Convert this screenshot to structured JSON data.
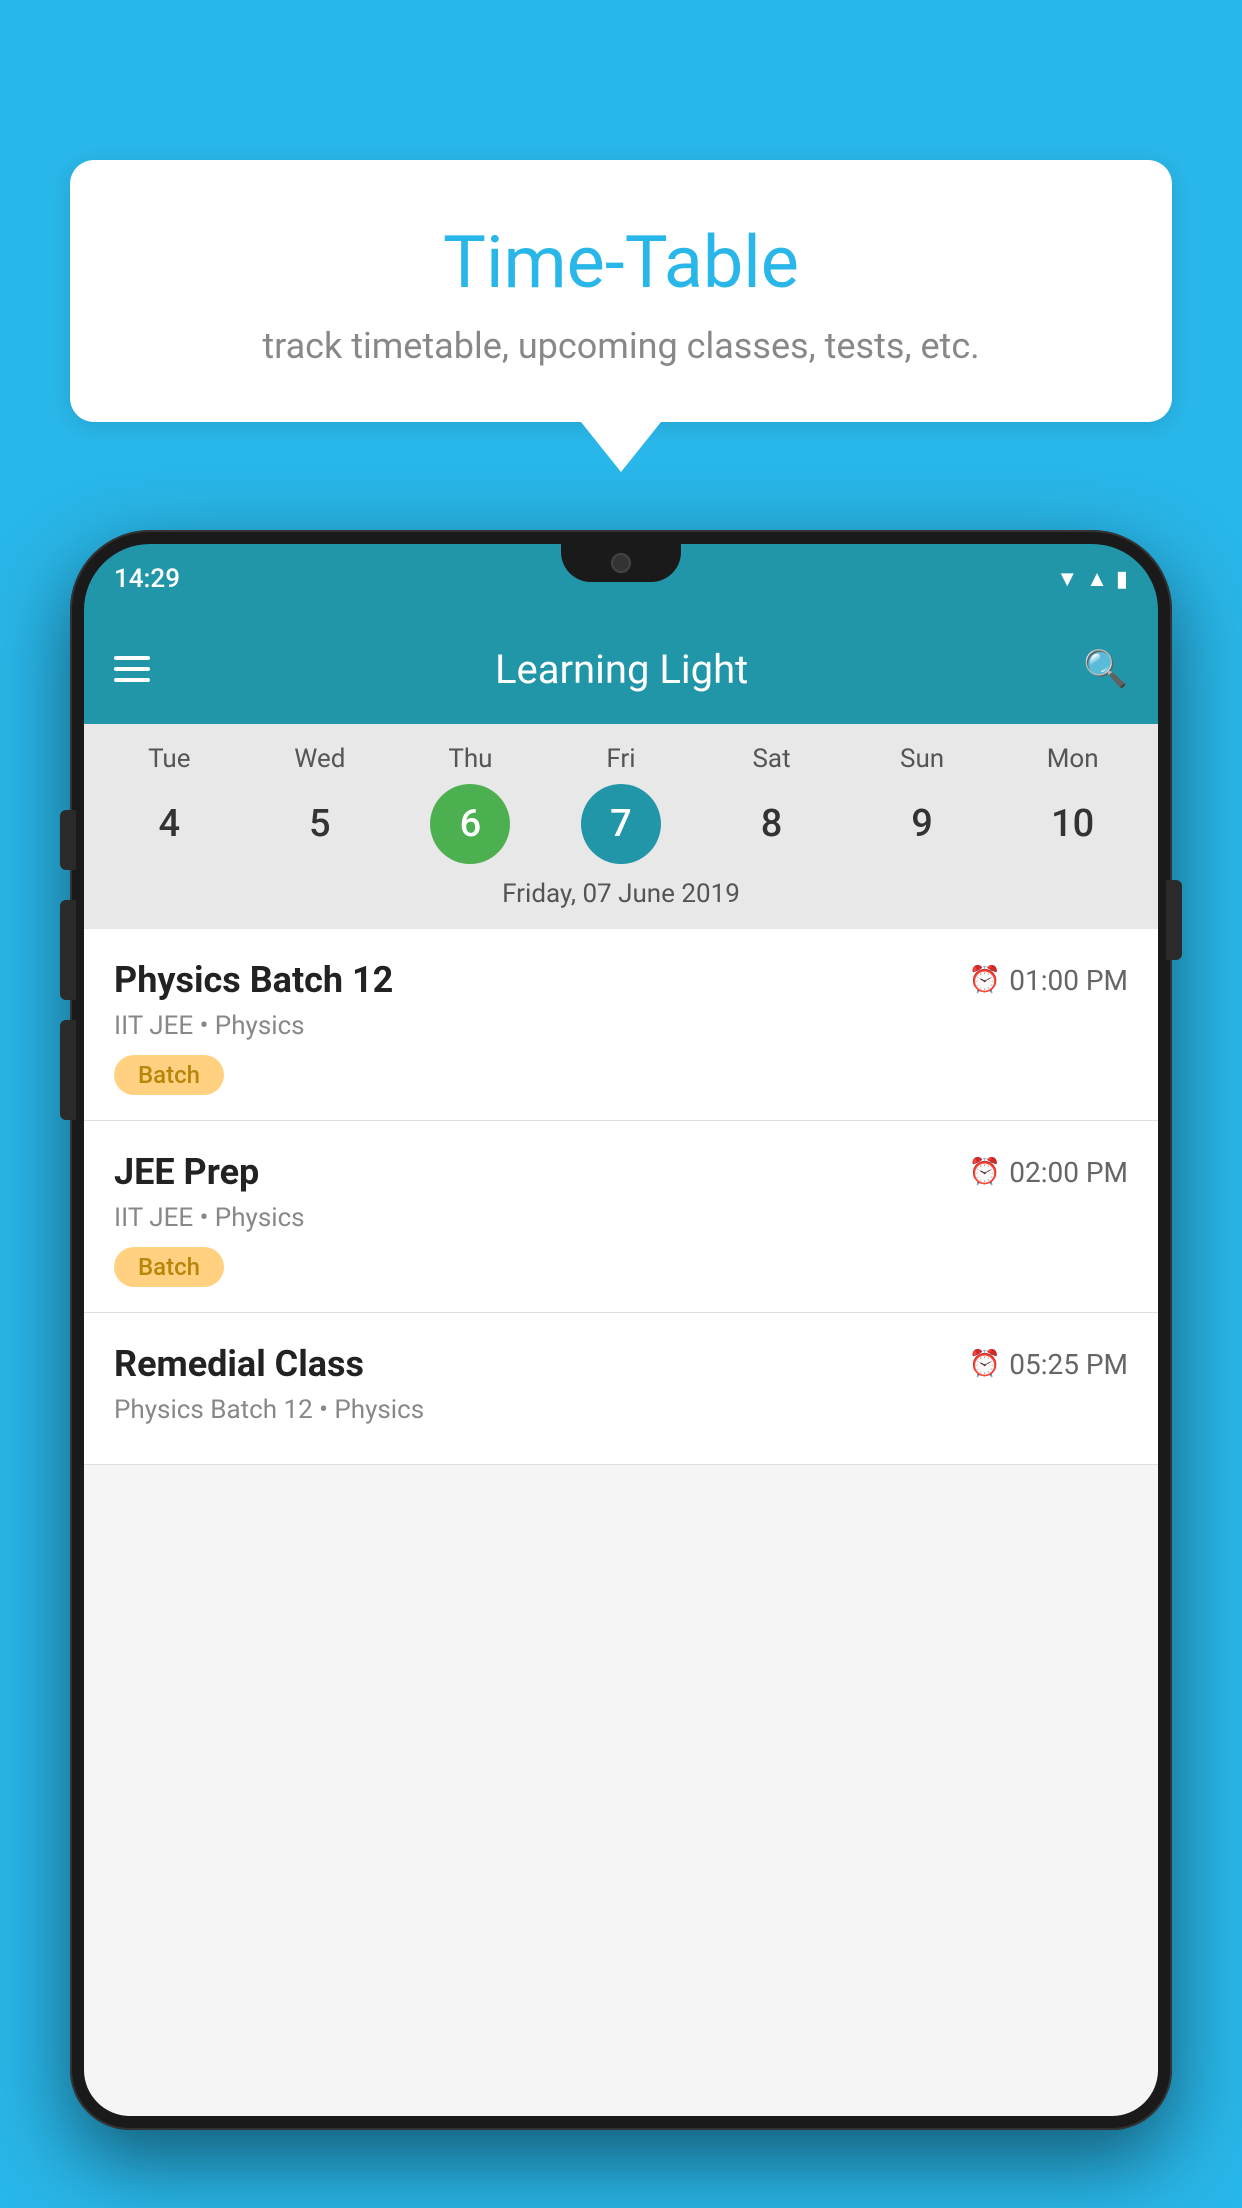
{
  "background_color": "#29b6e8",
  "speech_bubble": {
    "title": "Time-Table",
    "subtitle": "track timetable, upcoming classes, tests, etc."
  },
  "phone": {
    "status_bar": {
      "time": "14:29"
    },
    "app_bar": {
      "title": "Learning Light"
    },
    "calendar": {
      "days": [
        {
          "label": "Tue",
          "number": "4"
        },
        {
          "label": "Wed",
          "number": "5"
        },
        {
          "label": "Thu",
          "number": "6",
          "state": "today"
        },
        {
          "label": "Fri",
          "number": "7",
          "state": "selected"
        },
        {
          "label": "Sat",
          "number": "8"
        },
        {
          "label": "Sun",
          "number": "9"
        },
        {
          "label": "Mon",
          "number": "10"
        }
      ],
      "selected_date_label": "Friday, 07 June 2019"
    },
    "schedule": [
      {
        "title": "Physics Batch 12",
        "time": "01:00 PM",
        "subtitle": "IIT JEE • Physics",
        "badge": "Batch"
      },
      {
        "title": "JEE Prep",
        "time": "02:00 PM",
        "subtitle": "IIT JEE • Physics",
        "badge": "Batch"
      },
      {
        "title": "Remedial Class",
        "time": "05:25 PM",
        "subtitle": "Physics Batch 12 • Physics",
        "badge": null
      }
    ]
  }
}
